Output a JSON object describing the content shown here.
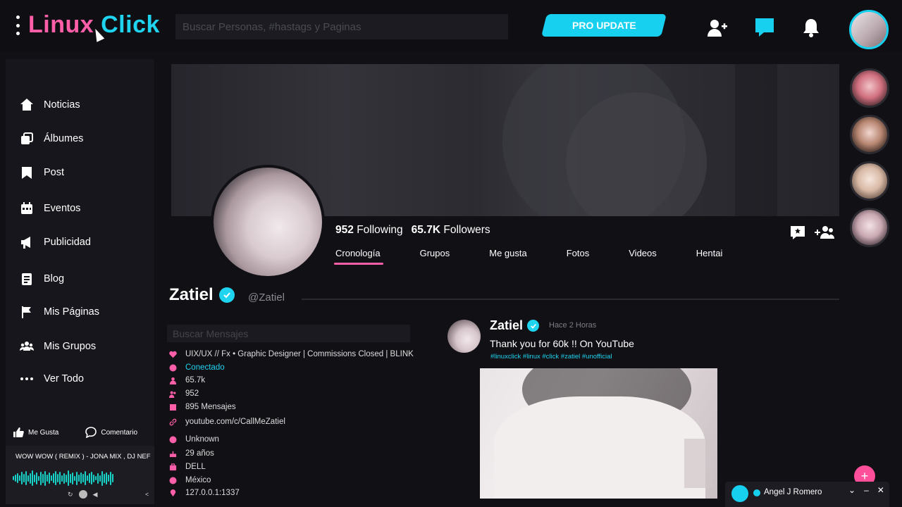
{
  "header": {
    "logo_part1": "Linux",
    "logo_part2": "Click",
    "search_placeholder": "Buscar Personas, #hastags y Paginas",
    "pro_button": "PRO UPDATE"
  },
  "sidebar": {
    "items": [
      {
        "label": "Noticias",
        "icon": "home-icon"
      },
      {
        "label": "Álbumes",
        "icon": "albums-icon"
      },
      {
        "label": "Post",
        "icon": "bookmark-icon"
      },
      {
        "label": "Eventos",
        "icon": "calendar-icon"
      },
      {
        "label": "Publicidad",
        "icon": "megaphone-icon"
      },
      {
        "label": "Blog",
        "icon": "blog-icon"
      },
      {
        "label": "Mis Páginas",
        "icon": "flag-icon"
      },
      {
        "label": "Mis Grupos",
        "icon": "groups-icon"
      },
      {
        "label": "Ver Todo",
        "icon": "more-icon"
      }
    ],
    "like_label": "Me Gusta",
    "comment_label": "Comentario"
  },
  "player": {
    "track": "WOW WOW ( REMIX ) - JONA MIX , DJ NEF"
  },
  "profile": {
    "following_count": "952",
    "following_label": "Following",
    "followers_count": "65.7K",
    "followers_label": "Followers",
    "tabs": [
      "Cronología",
      "Grupos",
      "Me gusta",
      "Fotos",
      "Videos",
      "Hentai"
    ],
    "name": "Zatiel",
    "handle": "@Zatiel",
    "search_messages_placeholder": "Buscar Mensajes",
    "info": [
      {
        "text": "UIX/UX // Fx • Graphic Designer | Commissions Closed | BLINK",
        "icon": "heart-icon"
      },
      {
        "text": "Conectado",
        "icon": "online-icon"
      },
      {
        "text": "65.7k",
        "icon": "followers-icon"
      },
      {
        "text": "952",
        "icon": "following-icon"
      },
      {
        "text": "895 Mensajes",
        "icon": "messages-icon"
      },
      {
        "text": "youtube.com/c/CallMeZatiel",
        "icon": "link-icon"
      },
      {
        "text": "Unknown",
        "icon": "gender-icon"
      },
      {
        "text": "29 años",
        "icon": "birthday-icon"
      },
      {
        "text": "DELL",
        "icon": "work-icon"
      },
      {
        "text": "México",
        "icon": "location-icon"
      },
      {
        "text": "127.0.0.1:1337",
        "icon": "ip-icon"
      }
    ]
  },
  "post": {
    "author": "Zatiel",
    "time": "Hace 2 Horas",
    "text": "Thank you for 60k !! On YouTube",
    "tags": "#linuxclick #linux #click #zatiel #unofficial"
  },
  "chat": {
    "name": "Angel J Romero"
  },
  "colors": {
    "accent_cyan": "#17d0ef",
    "accent_pink": "#ff5fa8",
    "background": "#111015"
  }
}
